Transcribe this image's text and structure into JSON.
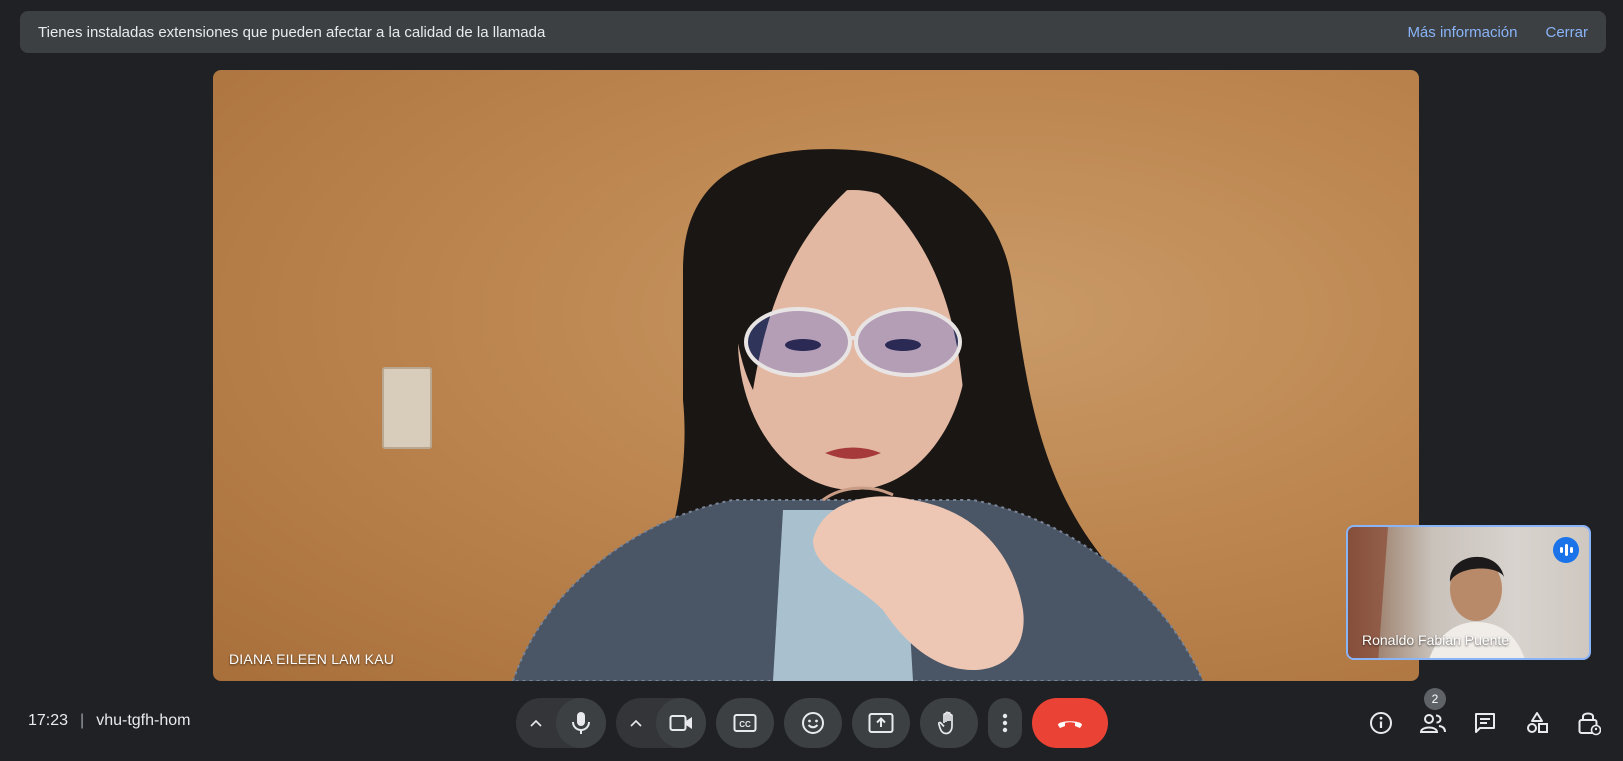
{
  "banner": {
    "message": "Tienes instaladas extensiones que pueden afectar a la calidad de la llamada",
    "more_info_label": "Más información",
    "close_label": "Cerrar"
  },
  "main_video": {
    "participant_name": "DIANA EILEEN LAM KAU"
  },
  "self_view": {
    "participant_name": "Ronaldo Fabian Puente"
  },
  "meeting": {
    "time": "17:23",
    "separator": "|",
    "code": "vhu-tgfh-hom"
  },
  "controls": {
    "mic_options_icon": "chevron-up-icon",
    "mic_icon": "mic-icon",
    "camera_options_icon": "chevron-up-icon",
    "camera_icon": "videocam-icon",
    "captions_icon": "closed-captions-icon",
    "emoji_icon": "emoji-icon",
    "present_icon": "present-screen-icon",
    "raise_hand_icon": "raise-hand-icon",
    "more_icon": "more-vert-icon",
    "end_call_icon": "call-end-icon"
  },
  "side_panel": {
    "people_count": "2"
  },
  "colors": {
    "background": "#202124",
    "accent": "#8ab4f8",
    "end_call": "#ea4335",
    "speaking": "#1a73e8"
  }
}
